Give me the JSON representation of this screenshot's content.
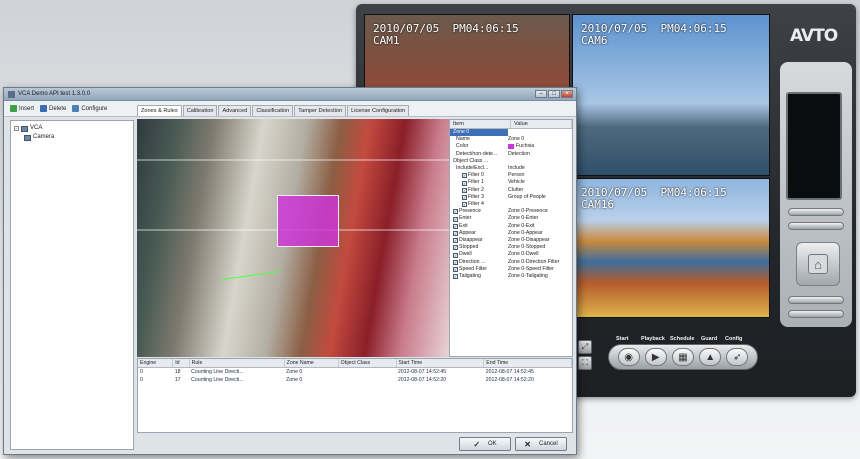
{
  "nvr": {
    "brand": "AVTO",
    "cameras": [
      {
        "osd": "2010/07/05  PM04:06:15\nCAM1"
      },
      {
        "osd": "2010/07/05  PM04:06:15\nCAM6"
      },
      {
        "osd": "2010/07/05  PM04:06:15\nCAM16"
      }
    ],
    "bottom_labels": [
      "Start",
      "Playback",
      "Schedule",
      "Guard",
      "Config"
    ]
  },
  "app": {
    "title": "VCA Demo API test 1.3.0.0",
    "toolbar": {
      "insert": "Insert",
      "delete": "Delete",
      "configure": "Configure"
    },
    "tabs": [
      "Zones & Rules",
      "Calibration",
      "Advanced",
      "Classification",
      "Tamper Detection",
      "License Configuration"
    ],
    "tree": {
      "root": "VCA",
      "child": "Camera"
    },
    "props": {
      "headers": [
        "Item",
        "Value"
      ],
      "rows": [
        {
          "k": "Zone 0",
          "v": "",
          "sel": true,
          "ind": 0,
          "cb": false
        },
        {
          "k": "Name",
          "v": "Zone 0",
          "ind": 1,
          "cb": false
        },
        {
          "k": "Color",
          "v": "Fuchsia",
          "ind": 1,
          "cb": false,
          "swatch": true
        },
        {
          "k": "Detect/non-dete...",
          "v": "Detection",
          "ind": 1,
          "cb": false
        },
        {
          "k": "Object Class ...",
          "v": "",
          "ind": 0,
          "cb": false
        },
        {
          "k": "Include/Excl...",
          "v": "Include",
          "ind": 1,
          "cb": false
        },
        {
          "k": "Filter 0",
          "v": "Person",
          "ind": 2,
          "cb": true
        },
        {
          "k": "Filter 1",
          "v": "Vehicle",
          "ind": 2,
          "cb": true
        },
        {
          "k": "Filter 2",
          "v": "Clutter",
          "ind": 2,
          "cb": true
        },
        {
          "k": "Filter 3",
          "v": "Group of People",
          "ind": 2,
          "cb": true
        },
        {
          "k": "Filter 4",
          "v": "",
          "ind": 2,
          "cb": true
        },
        {
          "k": "Presence",
          "v": "Zone 0-Presence",
          "ind": 0,
          "cb": true
        },
        {
          "k": "Enter",
          "v": "Zone 0-Enter",
          "ind": 0,
          "cb": true
        },
        {
          "k": "Exit",
          "v": "Zone 0-Exit",
          "ind": 0,
          "cb": true
        },
        {
          "k": "Appear",
          "v": "Zone 0-Appear",
          "ind": 0,
          "cb": true
        },
        {
          "k": "Disappear",
          "v": "Zone 0-Disappear",
          "ind": 0,
          "cb": true
        },
        {
          "k": "Stopped",
          "v": "Zone 0-Stopped",
          "ind": 0,
          "cb": true
        },
        {
          "k": "Dwell",
          "v": "Zone 0-Dwell",
          "ind": 0,
          "cb": true
        },
        {
          "k": "Direction ...",
          "v": "Zone 0-Direction Filter",
          "ind": 0,
          "cb": true
        },
        {
          "k": "Speed Filter",
          "v": "Zone 0-Speed Filter",
          "ind": 0,
          "cb": true
        },
        {
          "k": "Tailgating",
          "v": "Zone 0-Tailgating",
          "ind": 0,
          "cb": true
        }
      ]
    },
    "events": {
      "headers": [
        "Engine",
        "Id",
        "Rule",
        "Zone Name",
        "Object Class",
        "Start Time",
        "End Time"
      ],
      "rows": [
        [
          "0",
          "18",
          "Counting Line Directi...",
          "Zone 0",
          "",
          "2012-08-07 14:52:45",
          "2012-08-07 14:52:45"
        ],
        [
          "0",
          "17",
          "Counting Line Directi...",
          "Zone 0",
          "",
          "2012-08-07 14:52:20",
          "2012-08-07 14:52:20"
        ]
      ]
    },
    "buttons": {
      "ok": "OK",
      "cancel": "Cancel"
    }
  }
}
